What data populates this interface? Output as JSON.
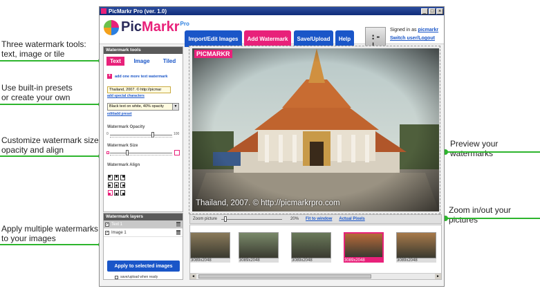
{
  "window": {
    "title": "PicMarkr Pro (ver. 1.0)",
    "btn_min": "_",
    "btn_max": "□",
    "btn_close": "×"
  },
  "logo": {
    "pic": "Pic",
    "markr": "Markr",
    "pro": "Pro"
  },
  "nav": {
    "import": "Import/Edit Images",
    "watermark": "Add Watermark",
    "saveupload": "Save/Upload",
    "help": "Help"
  },
  "user": {
    "signed_in_as": "Signed in as",
    "username": "picmarkr",
    "switch": "Switch user/Logout",
    "face": ":-|"
  },
  "watermark_tools": {
    "header": "Watermark tools",
    "tabs": {
      "text": "Text",
      "image": "Image",
      "tiled": "Tiled"
    },
    "add_more": "add one more text watermark",
    "text_value": "Thailand, 2007. © http://picmar",
    "add_special": "add special characters",
    "preset_value": "Black text on white, 40% opacity",
    "edit_preset": "edit/add preset",
    "opacity_label": "Watermark Opacity",
    "opacity_min": "0",
    "opacity_max": "100",
    "opacity_value": 0.7,
    "size_label": "Watermark Size",
    "size_value": 0.27,
    "align_label": "Watermark Align",
    "align_selected": "bottom-left"
  },
  "layers": {
    "header": "Watermark layers",
    "items": [
      {
        "label": "Text 1",
        "checked": true,
        "selected": true
      },
      {
        "label": "Image 1",
        "checked": true,
        "selected": false
      }
    ],
    "check_mark": "✓",
    "apply_button": "Apply to selected images",
    "save_when_ready": "save/upload when ready"
  },
  "preview": {
    "watermark_logo": "PICMARKR",
    "watermark_text": "Thailand, 2007. © http://picmarkrpro.com"
  },
  "zoom": {
    "label": "Zoom picture",
    "percent": "20%",
    "fit": "Fit to window",
    "actual": "Actual Pixels",
    "value": 0.05
  },
  "thumbnails": [
    {
      "caption": "3089x2048",
      "selected": false,
      "color": "#8a7a5a"
    },
    {
      "caption": "3089x2048",
      "selected": false,
      "color": "#7a8a6a"
    },
    {
      "caption": "3089x2048",
      "selected": false,
      "color": "#6a7a5a"
    },
    {
      "caption": "3089x2048",
      "selected": true,
      "color": "#b86a3a"
    },
    {
      "caption": "3089x2048",
      "selected": false,
      "color": "#a87a4a"
    }
  ],
  "scroll": {
    "left": "◄",
    "right": "►"
  },
  "callouts": {
    "tools": [
      "Three watermark tools:",
      "text, image or tile"
    ],
    "presets": [
      "Use built-in presets",
      "or create your own"
    ],
    "customize": [
      "Customize watermark size,",
      "opacity and align"
    ],
    "multiple": [
      "Apply multiple watermarks",
      "to your images"
    ],
    "preview": "Preview your watermarks",
    "zoom": "Zoom in/out your pictures"
  },
  "colors": {
    "accent_pink": "#e8217a",
    "nav_blue": "#1a56c8",
    "callout_green": "#2db52d"
  }
}
